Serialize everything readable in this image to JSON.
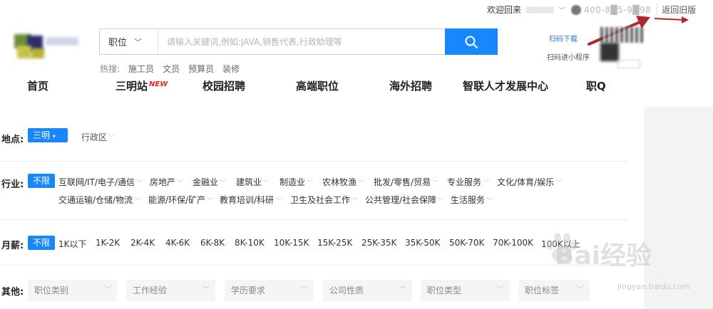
{
  "topbar": {
    "welcome": "欢迎回来",
    "phone": "400-8█5-9█98",
    "old_version": "返回旧版"
  },
  "search": {
    "category": "职位",
    "placeholder": "请输入关键词,例如:JAVA,销售代表,行政助理等"
  },
  "hot": {
    "label": "热搜:",
    "keywords": [
      "施工员",
      "文员",
      "预算员",
      "装修"
    ]
  },
  "qr": {
    "text1": "扫码下载",
    "text2": "扫码进小程序"
  },
  "nav": {
    "items": [
      "首页",
      "三明站",
      "校园招聘",
      "高端职位",
      "海外招聘",
      "智联人才发展中心",
      "职Q"
    ],
    "new_badge": "NEW"
  },
  "filters": {
    "location": {
      "label": "地点:",
      "selected": "三明",
      "option": "行政区"
    },
    "industry": {
      "label": "行业:",
      "selected": "不限",
      "row1": [
        "互联网/IT/电子/通信",
        "房地产",
        "金融业",
        "建筑业",
        "制造业",
        "农林牧渔",
        "批发/零售/贸易",
        "专业服务",
        "文化/体育/娱乐"
      ],
      "row2": [
        "交通运输/仓储/物流",
        "能源/环保/矿产",
        "教育培训/科研",
        "卫生及社会工作",
        "公共管理/社会保障",
        "生活服务"
      ]
    },
    "salary": {
      "label": "月薪:",
      "selected": "不限",
      "options": [
        "1K以下",
        "1K-2K",
        "2K-4K",
        "4K-6K",
        "6K-8K",
        "8K-10K",
        "10K-15K",
        "15K-25K",
        "25K-35K",
        "35K-50K",
        "50K-70K",
        "70K-100K",
        "100K以上"
      ]
    },
    "other": {
      "label": "其他:",
      "dropdowns": [
        "职位类别",
        "工作经验",
        "学历要求",
        "公司性质",
        "职位类型",
        "职位标签"
      ]
    }
  },
  "watermark": {
    "text": "Bai经验",
    "sub": "jingyan.baidu.com"
  },
  "colors": {
    "accent": "#1787fb",
    "new_badge": "#e1251b",
    "annotation_arrow": "#b3262e"
  }
}
